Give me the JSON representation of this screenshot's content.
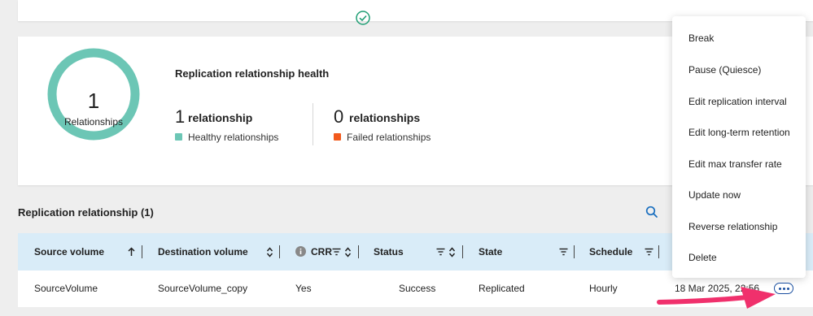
{
  "health": {
    "donut_count": "1",
    "donut_label": "Relationships",
    "title": "Replication relationship health",
    "healthy": {
      "count": "1",
      "unit": "relationship",
      "label": "Healthy relationships",
      "color": "#6cc6b5"
    },
    "failed": {
      "count": "0",
      "unit": "relationships",
      "label": "Failed relationships",
      "color": "#f25a1d"
    }
  },
  "table": {
    "title": "Replication relationship (1)",
    "columns": {
      "source": "Source volume",
      "destination": "Destination volume",
      "crr": "CRR",
      "status": "Status",
      "state": "State",
      "schedule": "Schedule"
    },
    "row": {
      "source": "SourceVolume",
      "destination": "SourceVolume_copy",
      "crr": "Yes",
      "status": "Success",
      "state": "Replicated",
      "schedule": "Hourly",
      "date": "18 Mar 2025, 22:56"
    }
  },
  "menu": {
    "items": [
      "Break",
      "Pause (Quiesce)",
      "Edit replication interval",
      "Edit long-term retention",
      "Edit max transfer rate",
      "Update now",
      "Reverse relationship",
      "Delete"
    ]
  },
  "colors": {
    "accent": "#1a4fa0",
    "header_bg": "#d9ecf8",
    "success": "#1f9e74",
    "arrow": "#f0306c"
  }
}
